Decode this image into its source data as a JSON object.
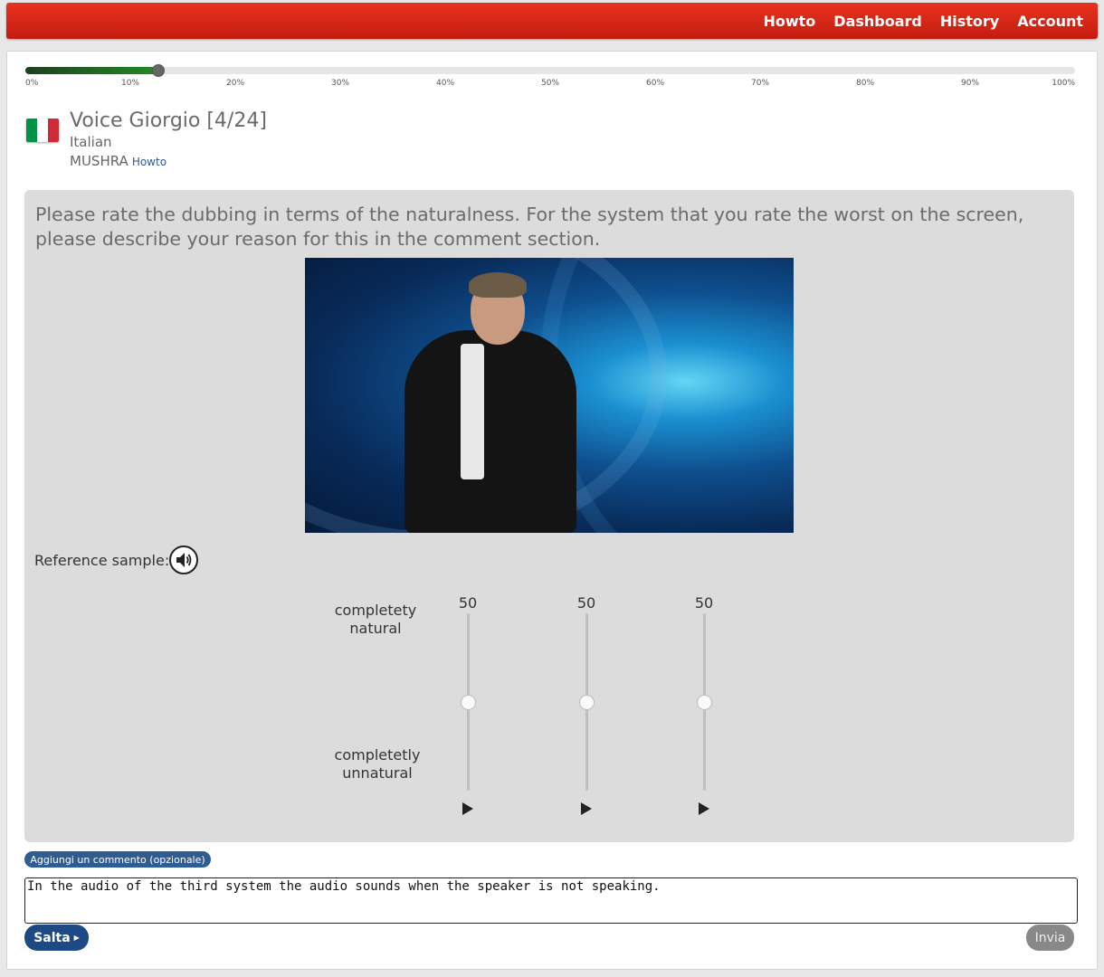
{
  "nav": {
    "items": [
      {
        "label": "Howto"
      },
      {
        "label": "Dashboard"
      },
      {
        "label": "History"
      },
      {
        "label": "Account"
      }
    ]
  },
  "progress": {
    "value_percent": 12.7,
    "ticks": [
      "0%",
      "10%",
      "20%",
      "30%",
      "40%",
      "50%",
      "60%",
      "70%",
      "80%",
      "90%",
      "100%"
    ]
  },
  "task": {
    "title": "Voice Giorgio [4/24]",
    "language": "Italian",
    "mode": "MUSHRA",
    "howto_link": "Howto",
    "flag_colors": [
      "#009246",
      "#ffffff",
      "#ce2b37"
    ]
  },
  "instruction": "Please rate the dubbing in terms of the naturalness. For the system that you rate the worst on the screen, please describe your reason for this in the comment section.",
  "reference_label": "Reference sample:",
  "scale": {
    "top_label": "completety natural",
    "bottom_label": "completetly unnatural"
  },
  "sliders": [
    {
      "value": "50"
    },
    {
      "value": "50"
    },
    {
      "value": "50"
    }
  ],
  "comment": {
    "button_label": "Aggiungi un commento (opzionale)",
    "text": "In the audio of the third system the audio sounds when the speaker is not speaking."
  },
  "actions": {
    "skip_label": "Salta",
    "submit_label": "Invia"
  }
}
